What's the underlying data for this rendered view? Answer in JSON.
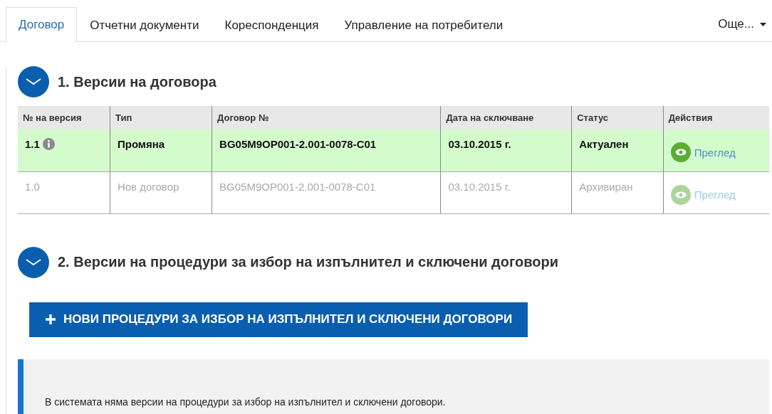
{
  "tabs": [
    {
      "label": "Договор",
      "selected": true
    },
    {
      "label": "Отчетни документи",
      "selected": false
    },
    {
      "label": "Кореспонденция",
      "selected": false
    },
    {
      "label": "Управление на потребители",
      "selected": false
    }
  ],
  "more_menu": {
    "label": "Още..."
  },
  "sections": [
    {
      "title": "1. Версии на договора",
      "expanded": true,
      "table": {
        "columns": [
          "№ на версия",
          "Тип",
          "Договор №",
          "Дата на сключване",
          "Статус",
          "Действия"
        ],
        "rows": [
          {
            "version": "1.1",
            "info": true,
            "type": "Промяна",
            "contract": "BG05M9OP001-2.001-0078-C01",
            "date": "03.10.2015 г.",
            "status": "Актуален",
            "action": "Преглед",
            "current": true
          },
          {
            "version": "1.0",
            "info": false,
            "type": "Нов договор",
            "contract": "BG05M9OP001-2.001-0078-C01",
            "date": "03.10.2015 г.",
            "status": "Архивиран",
            "action": "Преглед",
            "current": false
          }
        ]
      }
    },
    {
      "title": "2. Версии на процедури за избор на изпълнител и сключени договори",
      "expanded": true,
      "button": "НОВИ ПРОЦЕДУРИ ЗА ИЗБОР НА ИЗПЪЛНИТЕЛ И СКЛЮЧЕНИ ДОГОВОРИ",
      "notice": "В системата няма версии на процедури за избор на изпълнител и сключени договори."
    }
  ]
}
